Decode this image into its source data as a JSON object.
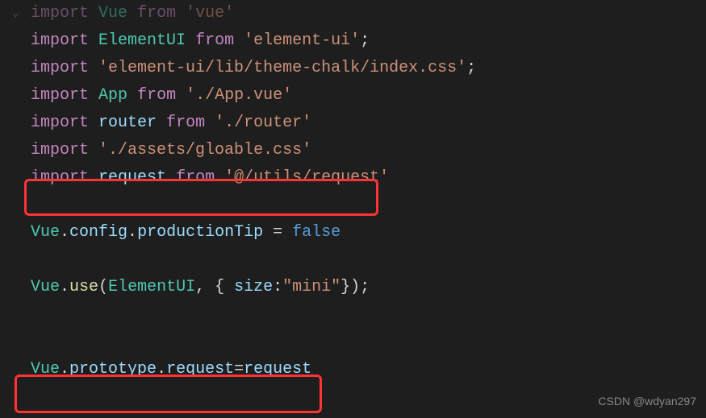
{
  "code": {
    "line1_import": "import",
    "line1_vue": "Vue",
    "line1_from": "from",
    "line1_str": "'vue'",
    "line2_import": "import",
    "line2_ident": "ElementUI",
    "line2_from": "from",
    "line2_str": "'element-ui'",
    "line2_semi": ";",
    "line3_import": "import",
    "line3_str": "'element-ui/lib/theme-chalk/index.css'",
    "line3_semi": ";",
    "line4_import": "import",
    "line4_ident": "App",
    "line4_from": "from",
    "line4_str": "'./App.vue'",
    "line5_import": "import",
    "line5_ident": "router",
    "line5_from": "from",
    "line5_str": "'./router'",
    "line6_import": "import",
    "line6_str": "'./assets/gloable.css'",
    "line7_import": "import",
    "line7_ident": "request",
    "line7_from": "from",
    "line7_str": "'@/utils/request'",
    "line9_vue": "Vue",
    "line9_dot1": ".",
    "line9_config": "config",
    "line9_dot2": ".",
    "line9_tip": "productionTip",
    "line9_eq": " = ",
    "line9_false": "false",
    "line11_vue": "Vue",
    "line11_dot": ".",
    "line11_use": "use",
    "line11_open": "(",
    "line11_elementui": "ElementUI",
    "line11_comma": ", { ",
    "line11_size": "size",
    "line11_colon": ":",
    "line11_mini": "\"mini\"",
    "line11_close": "});",
    "line13_vue": "Vue",
    "line13_dot1": ".",
    "line13_proto": "prototype",
    "line13_dot2": ".",
    "line13_req": "request",
    "line13_eq": "=",
    "line13_reqval": "request"
  },
  "watermark": "CSDN @wdyan297"
}
